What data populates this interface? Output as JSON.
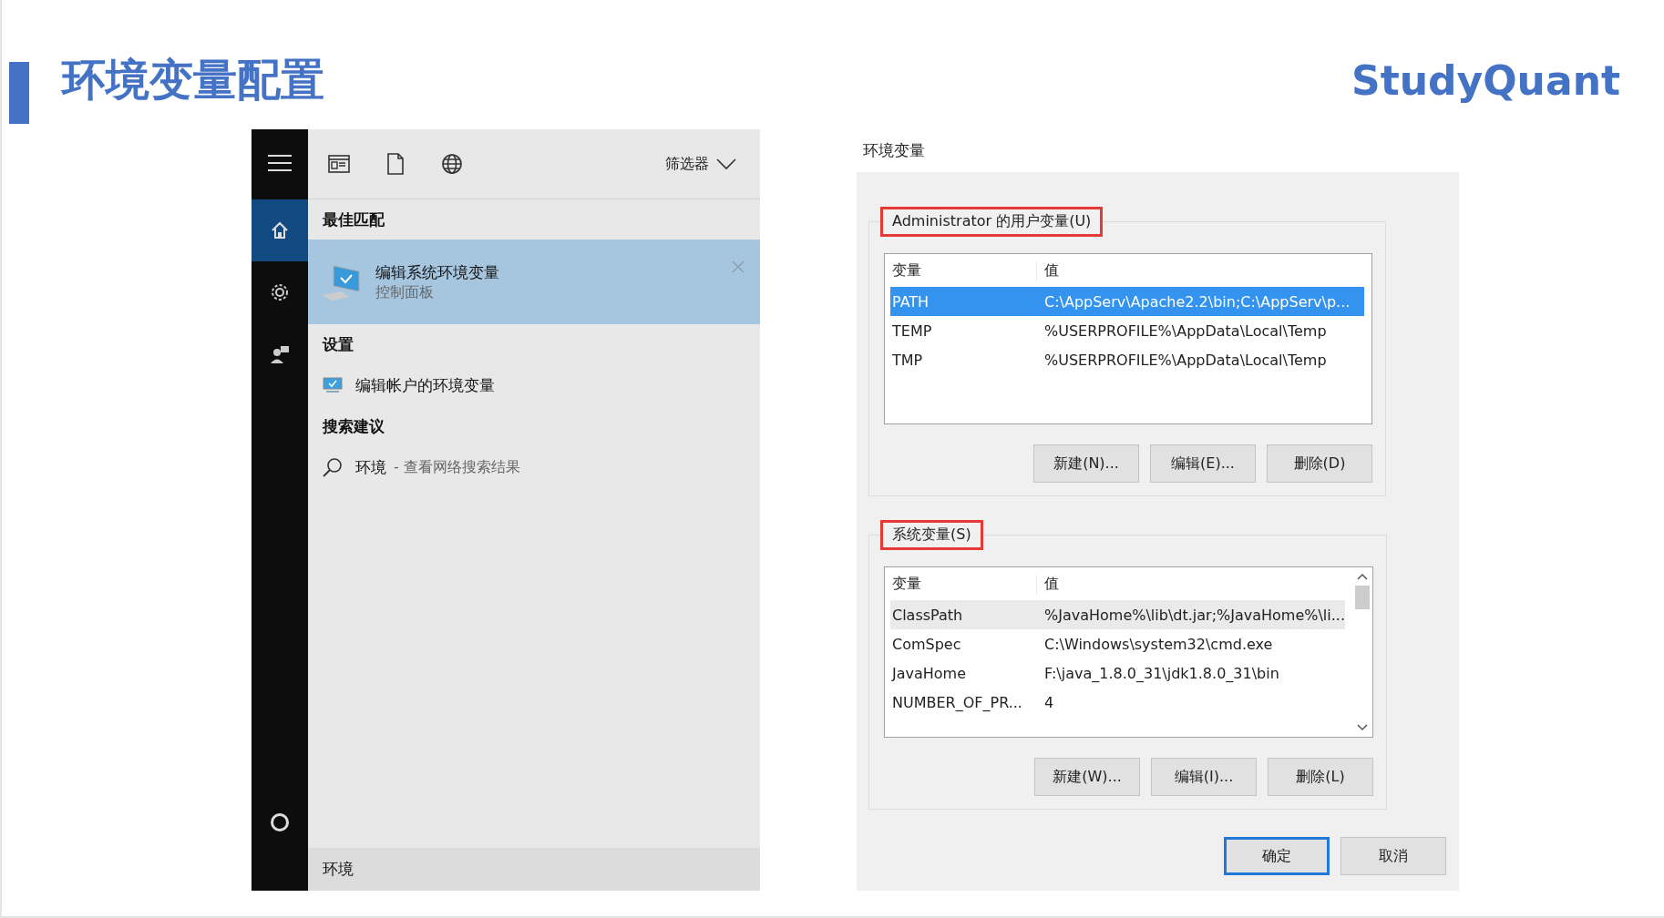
{
  "slide": {
    "title": "环境变量配置",
    "brand": "StudyQuant"
  },
  "search_panel": {
    "sidebar": [
      {
        "kind": "home",
        "selected": true
      },
      {
        "kind": "settings",
        "selected": false
      },
      {
        "kind": "feedback",
        "selected": false
      }
    ],
    "filter": {
      "label": "筛选器"
    },
    "sections": [
      {
        "heading": "最佳匹配",
        "items": [
          {
            "kind": "app",
            "title": "编辑系统环境变量",
            "subtitle": "控制面板",
            "selected": true
          }
        ]
      },
      {
        "heading": "设置",
        "items": [
          {
            "kind": "setting",
            "title": "编辑帐户的环境变量",
            "selected": false
          }
        ]
      },
      {
        "heading": "搜索建议",
        "items": [
          {
            "kind": "web",
            "title": "环境",
            "subtitle": "- 查看网络搜索结果",
            "selected": false
          }
        ]
      }
    ],
    "search_box": {
      "value": "环境"
    }
  },
  "dialog": {
    "title": "环境变量",
    "groups": [
      {
        "legend": "Administrator 的用户变量(U)",
        "highlighted": true,
        "scrollbar": false,
        "columns": [
          "变量",
          "值"
        ],
        "rows": [
          {
            "name": "PATH",
            "value": "C:\\AppServ\\Apache2.2\\bin;C:\\AppServ\\p...",
            "selected": true,
            "hovered": false
          },
          {
            "name": "TEMP",
            "value": "%USERPROFILE%\\AppData\\Local\\Temp",
            "selected": false,
            "hovered": false
          },
          {
            "name": "TMP",
            "value": "%USERPROFILE%\\AppData\\Local\\Temp",
            "selected": false,
            "hovered": false
          }
        ],
        "buttons": [
          "新建(N)...",
          "编辑(E)...",
          "删除(D)"
        ]
      },
      {
        "legend": "系统变量(S)",
        "highlighted": true,
        "scrollbar": true,
        "columns": [
          "变量",
          "值"
        ],
        "rows": [
          {
            "name": "ClassPath",
            "value": "%JavaHome%\\lib\\dt.jar;%JavaHome%\\li...",
            "selected": false,
            "hovered": true
          },
          {
            "name": "ComSpec",
            "value": "C:\\Windows\\system32\\cmd.exe",
            "selected": false,
            "hovered": false
          },
          {
            "name": "JavaHome",
            "value": "F:\\java_1.8.0_31\\jdk1.8.0_31\\bin",
            "selected": false,
            "hovered": false
          },
          {
            "name": "NUMBER_OF_PR...",
            "value": "4",
            "selected": false,
            "hovered": false
          }
        ],
        "buttons": [
          "新建(W)...",
          "编辑(I)...",
          "删除(L)"
        ]
      }
    ],
    "buttons": [
      {
        "label": "确定",
        "default": true
      },
      {
        "label": "取消",
        "default": false
      }
    ]
  }
}
